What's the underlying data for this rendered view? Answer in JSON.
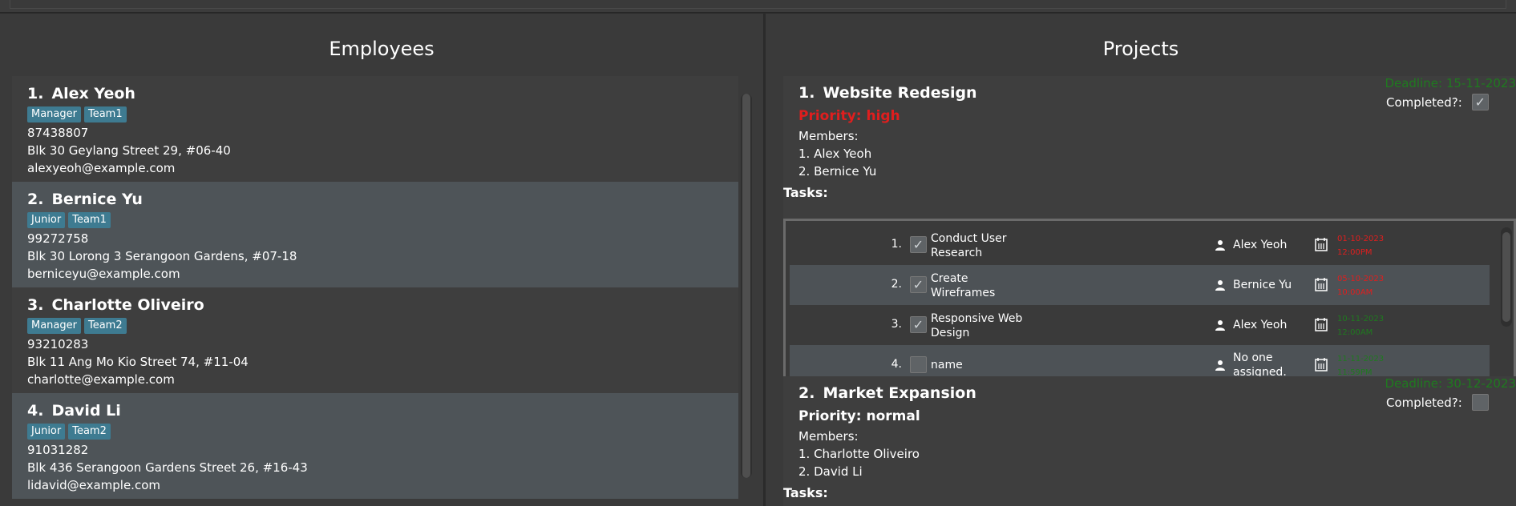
{
  "employees": {
    "title": "Employees",
    "list": [
      {
        "index": "1.",
        "name": "Alex Yeoh",
        "tags": [
          "Manager",
          "Team1"
        ],
        "phone": "87438807",
        "address": "Blk 30 Geylang Street 29, #06-40",
        "email": "alexyeoh@example.com"
      },
      {
        "index": "2.",
        "name": "Bernice Yu",
        "tags": [
          "Junior",
          "Team1"
        ],
        "phone": "99272758",
        "address": "Blk 30 Lorong 3 Serangoon Gardens, #07-18",
        "email": "berniceyu@example.com"
      },
      {
        "index": "3.",
        "name": "Charlotte Oliveiro",
        "tags": [
          "Manager",
          "Team2"
        ],
        "phone": "93210283",
        "address": "Blk 11 Ang Mo Kio Street 74, #11-04",
        "email": "charlotte@example.com"
      },
      {
        "index": "4.",
        "name": "David Li",
        "tags": [
          "Junior",
          "Team2"
        ],
        "phone": "91031282",
        "address": "Blk 436 Serangoon Gardens Street 26, #16-43",
        "email": "lidavid@example.com"
      }
    ]
  },
  "projects": {
    "title": "Projects",
    "list": [
      {
        "index": "1.",
        "name": "Website Redesign",
        "deadline": "Deadline: 15-11-2023",
        "completed_label": "Completed?:",
        "completed": true,
        "priority": "Priority: high",
        "members_label": "Members:",
        "members": [
          "1. Alex Yeoh",
          "2. Bernice Yu"
        ],
        "tasks_label": "Tasks:",
        "tasks": [
          {
            "index": "1.",
            "done": true,
            "name": "Conduct User Research",
            "assignee": "Alex Yeoh",
            "due_date": "01-10-2023",
            "due_time": "12:00PM",
            "due_color": "#e01e1e"
          },
          {
            "index": "2.",
            "done": true,
            "name": "Create Wireframes",
            "assignee": "Bernice Yu",
            "due_date": "05-10-2023",
            "due_time": "10:00AM",
            "due_color": "#e01e1e"
          },
          {
            "index": "3.",
            "done": true,
            "name": "Responsive Web Design",
            "assignee": "Alex Yeoh",
            "due_date": "10-11-2023",
            "due_time": "12:00AM",
            "due_color": "#1f7a1f"
          },
          {
            "index": "4.",
            "done": false,
            "name": "name",
            "assignee": "No one assigned.",
            "due_date": "11-11-2023",
            "due_time": "11:59PM",
            "due_color": "#1f7a1f"
          }
        ]
      },
      {
        "index": "2.",
        "name": "Market Expansion",
        "deadline": "Deadline: 30-12-2023",
        "completed_label": "Completed?:",
        "completed": false,
        "priority": "Priority: normal",
        "members_label": "Members:",
        "members": [
          "1. Charlotte Oliveiro",
          "2. David Li"
        ],
        "tasks_label": "Tasks:"
      }
    ]
  },
  "colors": {
    "tag_bg": "#3e7b91",
    "priority_high": "#e01e1e",
    "overdue": "#e01e1e",
    "on_time": "#1f7a1f"
  }
}
